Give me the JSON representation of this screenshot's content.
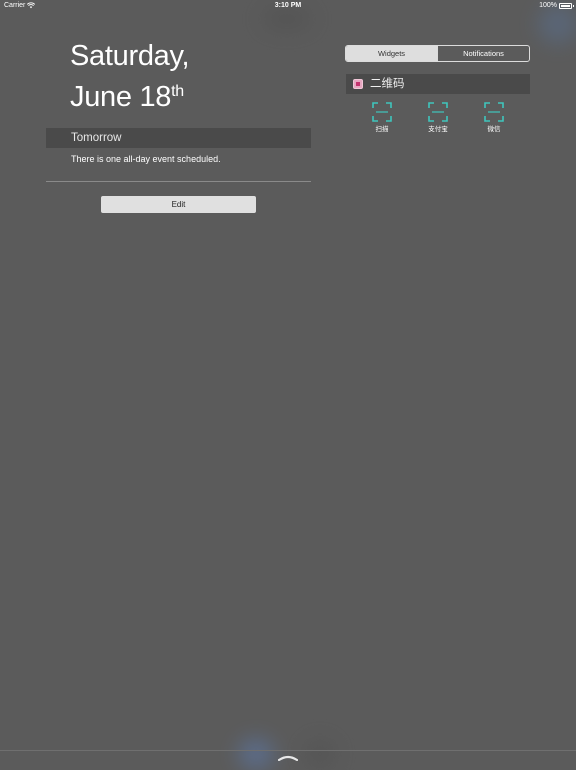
{
  "status_bar": {
    "carrier": "Carrier",
    "time": "3:10 PM",
    "battery": "100%"
  },
  "date": {
    "line1": "Saturday,",
    "line2": "June 18",
    "suffix": "th"
  },
  "tomorrow": {
    "title": "Tomorrow",
    "event_text": "There is one all-day event scheduled."
  },
  "edit_button": "Edit",
  "tabs": [
    {
      "label": "Widgets",
      "active": true
    },
    {
      "label": "Notifications",
      "active": false
    }
  ],
  "widget": {
    "title": "二维码",
    "accent": "#3fc6bd",
    "items": [
      {
        "label": "扫描",
        "icon": "qr-scan-icon"
      },
      {
        "label": "支付宝",
        "icon": "qr-scan-icon"
      },
      {
        "label": "微信",
        "icon": "qr-scan-icon"
      }
    ]
  }
}
